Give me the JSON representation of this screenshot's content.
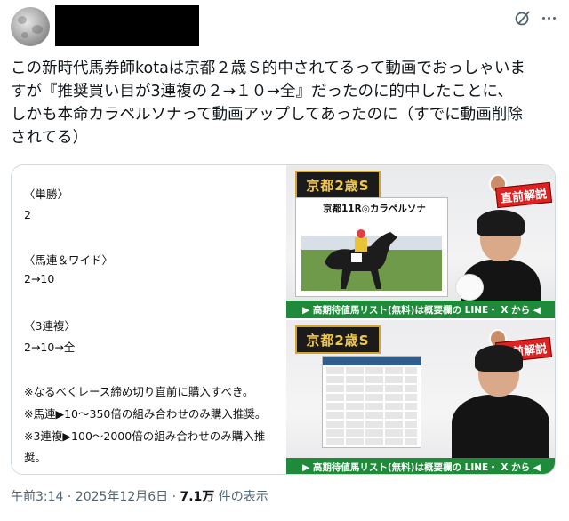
{
  "tweet": {
    "lines": [
      "この新時代馬券師kotaは京都２歳Ｓ的中されてるって動画でおっしゃいま",
      "すが『推奨買い目が3連複の２→１０→全』だったのに的中したことに、",
      "しかも本命カラペルソナって動画アップしてあったのに（すでに動画削除",
      "されてる）"
    ]
  },
  "image_left": {
    "notes": [
      "〈単勝〉",
      "2",
      "〈馬連＆ワイド〉",
      "2→10",
      "〈3連複〉",
      "2→10→全",
      "※なるべくレース締め切り直前に購入すべき。",
      "※馬連▶10〜350倍の組み合わせのみ購入推奨。",
      "※3連複▶100〜2000倍の組み合わせのみ購入推",
      "奨。"
    ]
  },
  "thumbs": {
    "race_title": "京都2歳S",
    "badge": "直前解説",
    "horse_caption": "京都11R◎カラペルソナ",
    "banner": "▶ 高期待値馬リスト(無料)は概要欄の LINE・ X から ◀"
  },
  "meta": {
    "time_date": "午前3:14 · 2025年12月6日 · ",
    "views": "7.1万",
    "views_suffix": " 件の表示"
  },
  "icons": [
    "avatar-moon",
    "grok-icon",
    "more-icon"
  ]
}
